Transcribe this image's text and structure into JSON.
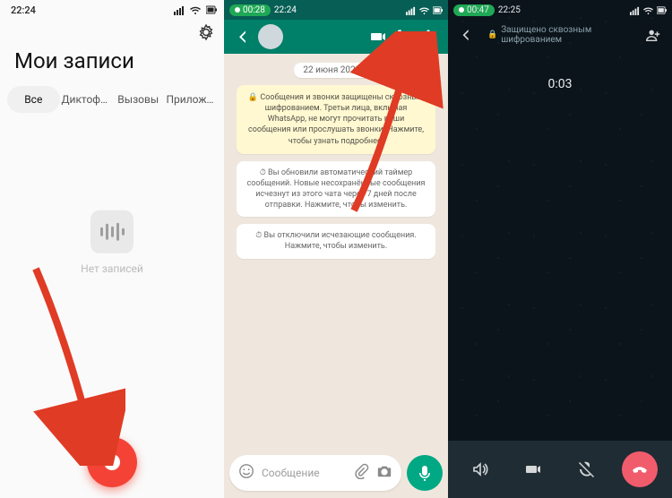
{
  "screens": {
    "recorder": {
      "status_time": "22:24",
      "title": "Мои записи",
      "tabs": [
        "Все",
        "Диктофон",
        "Вызовы",
        "Приложения"
      ],
      "empty_message": "Нет записей"
    },
    "chat": {
      "status_time": "22:24",
      "rec_pill": "00:28",
      "date_chip": "22 июня 2023 г.",
      "encryption_notice": "Сообщения и звонки защищены сквозным шифрованием. Третьи лица, включая WhatsApp, не могут прочитать ваши сообщения или прослушать звонки. Нажмите, чтобы узнать подробнее.",
      "system_messages": [
        "Вы обновили автоматический таймер сообщений. Новые несохранённые сообщения исчезнут из этого чата через 7 дней после отправки. Нажмите, чтобы изменить.",
        "Вы отключили исчезающие сообщения. Нажмите, чтобы изменить."
      ],
      "composer_placeholder": "Сообщение"
    },
    "call": {
      "status_time": "22:25",
      "rec_pill": "00:47",
      "encryption_label": "Защищено сквозным шифрованием",
      "timer": "0:03"
    }
  },
  "icons": {
    "gear": "gear-icon",
    "back": "back-icon",
    "video": "video-icon",
    "phone": "phone-icon",
    "more": "more-icon",
    "emoji": "emoji-icon",
    "attach": "attach-icon",
    "camera": "camera-icon",
    "mic": "mic-icon",
    "speaker": "speaker-icon",
    "mic_off": "mic-off-icon",
    "hangup": "hangup-icon",
    "lock": "lock-icon",
    "add_person": "add-person-icon",
    "signal": "signal-icon",
    "wifi": "wifi-icon",
    "battery": "battery-icon"
  },
  "colors": {
    "record_red": "#f44336",
    "whatsapp_header": "#008069",
    "whatsapp_fab": "#00a884",
    "hangup_red": "#f15c6d",
    "arrow_red": "#e03b24"
  }
}
